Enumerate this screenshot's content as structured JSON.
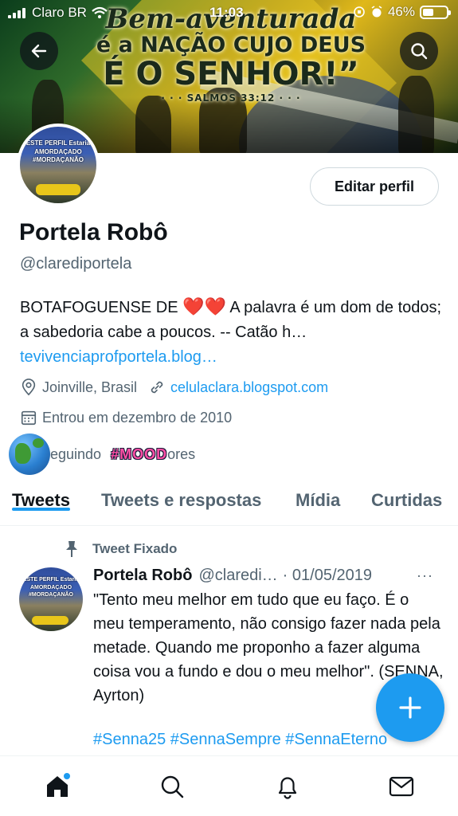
{
  "status_bar": {
    "carrier": "Claro BR",
    "time": "11:03",
    "battery": "46%",
    "battery_level": 0.46
  },
  "banner": {
    "line1": "Bem-aventurada",
    "line2": "é a NAÇÃO CUJO DEUS",
    "line3": "É O SENHOR!”",
    "line4": "· · · SALMOS 33:12 · · ·"
  },
  "avatar": {
    "text1": "ESTE PERFIL Estaria",
    "text2": "AMORDAÇADO",
    "text3": "#MORDAÇANÃO"
  },
  "profile": {
    "edit_button": "Editar perfil",
    "name": "Portela Robô",
    "handle": "@clarediportela",
    "bio_start": "BOTAFOGUENSE DE",
    "bio_hearts": "❤️❤️",
    "bio_end": "A palavra é um dom de todos; a sabedoria cabe a poucos. -- Catão h…",
    "bio_link": "tevivenciaprofportela.blog…",
    "location": "Joinville, Brasil",
    "website": "celulaclara.blogspot.com",
    "joined": "Entrou em dezembro de 2010",
    "following_partial": "eguindo",
    "followers_partial": "ores",
    "sticker_text": "#MOOD"
  },
  "tabs": [
    {
      "label": "Tweets",
      "active": true
    },
    {
      "label": "Tweets e respostas",
      "active": false
    },
    {
      "label": "Mídia",
      "active": false
    },
    {
      "label": "Curtidas",
      "active": false
    }
  ],
  "tweet": {
    "pinned_label": "Tweet Fixado",
    "author_name": "Portela Robô",
    "author_handle": "@claredi…",
    "date": "· 01/05/2019",
    "more": "···",
    "text": "\"Tento meu melhor em tudo que eu faço. É o meu temperamento, não consigo fazer nada pela metade. Quando me proponho a fazer alguma coisa vou a fundo e dou o meu melhor\". (SENNA, Ayrton)",
    "hashtags": "#Senna25 #SennaSempre #SennaEterno"
  },
  "fab": {
    "label": "+"
  },
  "colors": {
    "accent": "#1d9bf0",
    "text": "#0f1419",
    "secondary": "#536471"
  },
  "icons": [
    "back-arrow-icon",
    "search-icon",
    "location-pin-icon",
    "link-icon",
    "calendar-icon",
    "pin-icon",
    "home-icon",
    "notifications-bell-icon",
    "messages-mail-icon",
    "compose-plus-icon"
  ]
}
